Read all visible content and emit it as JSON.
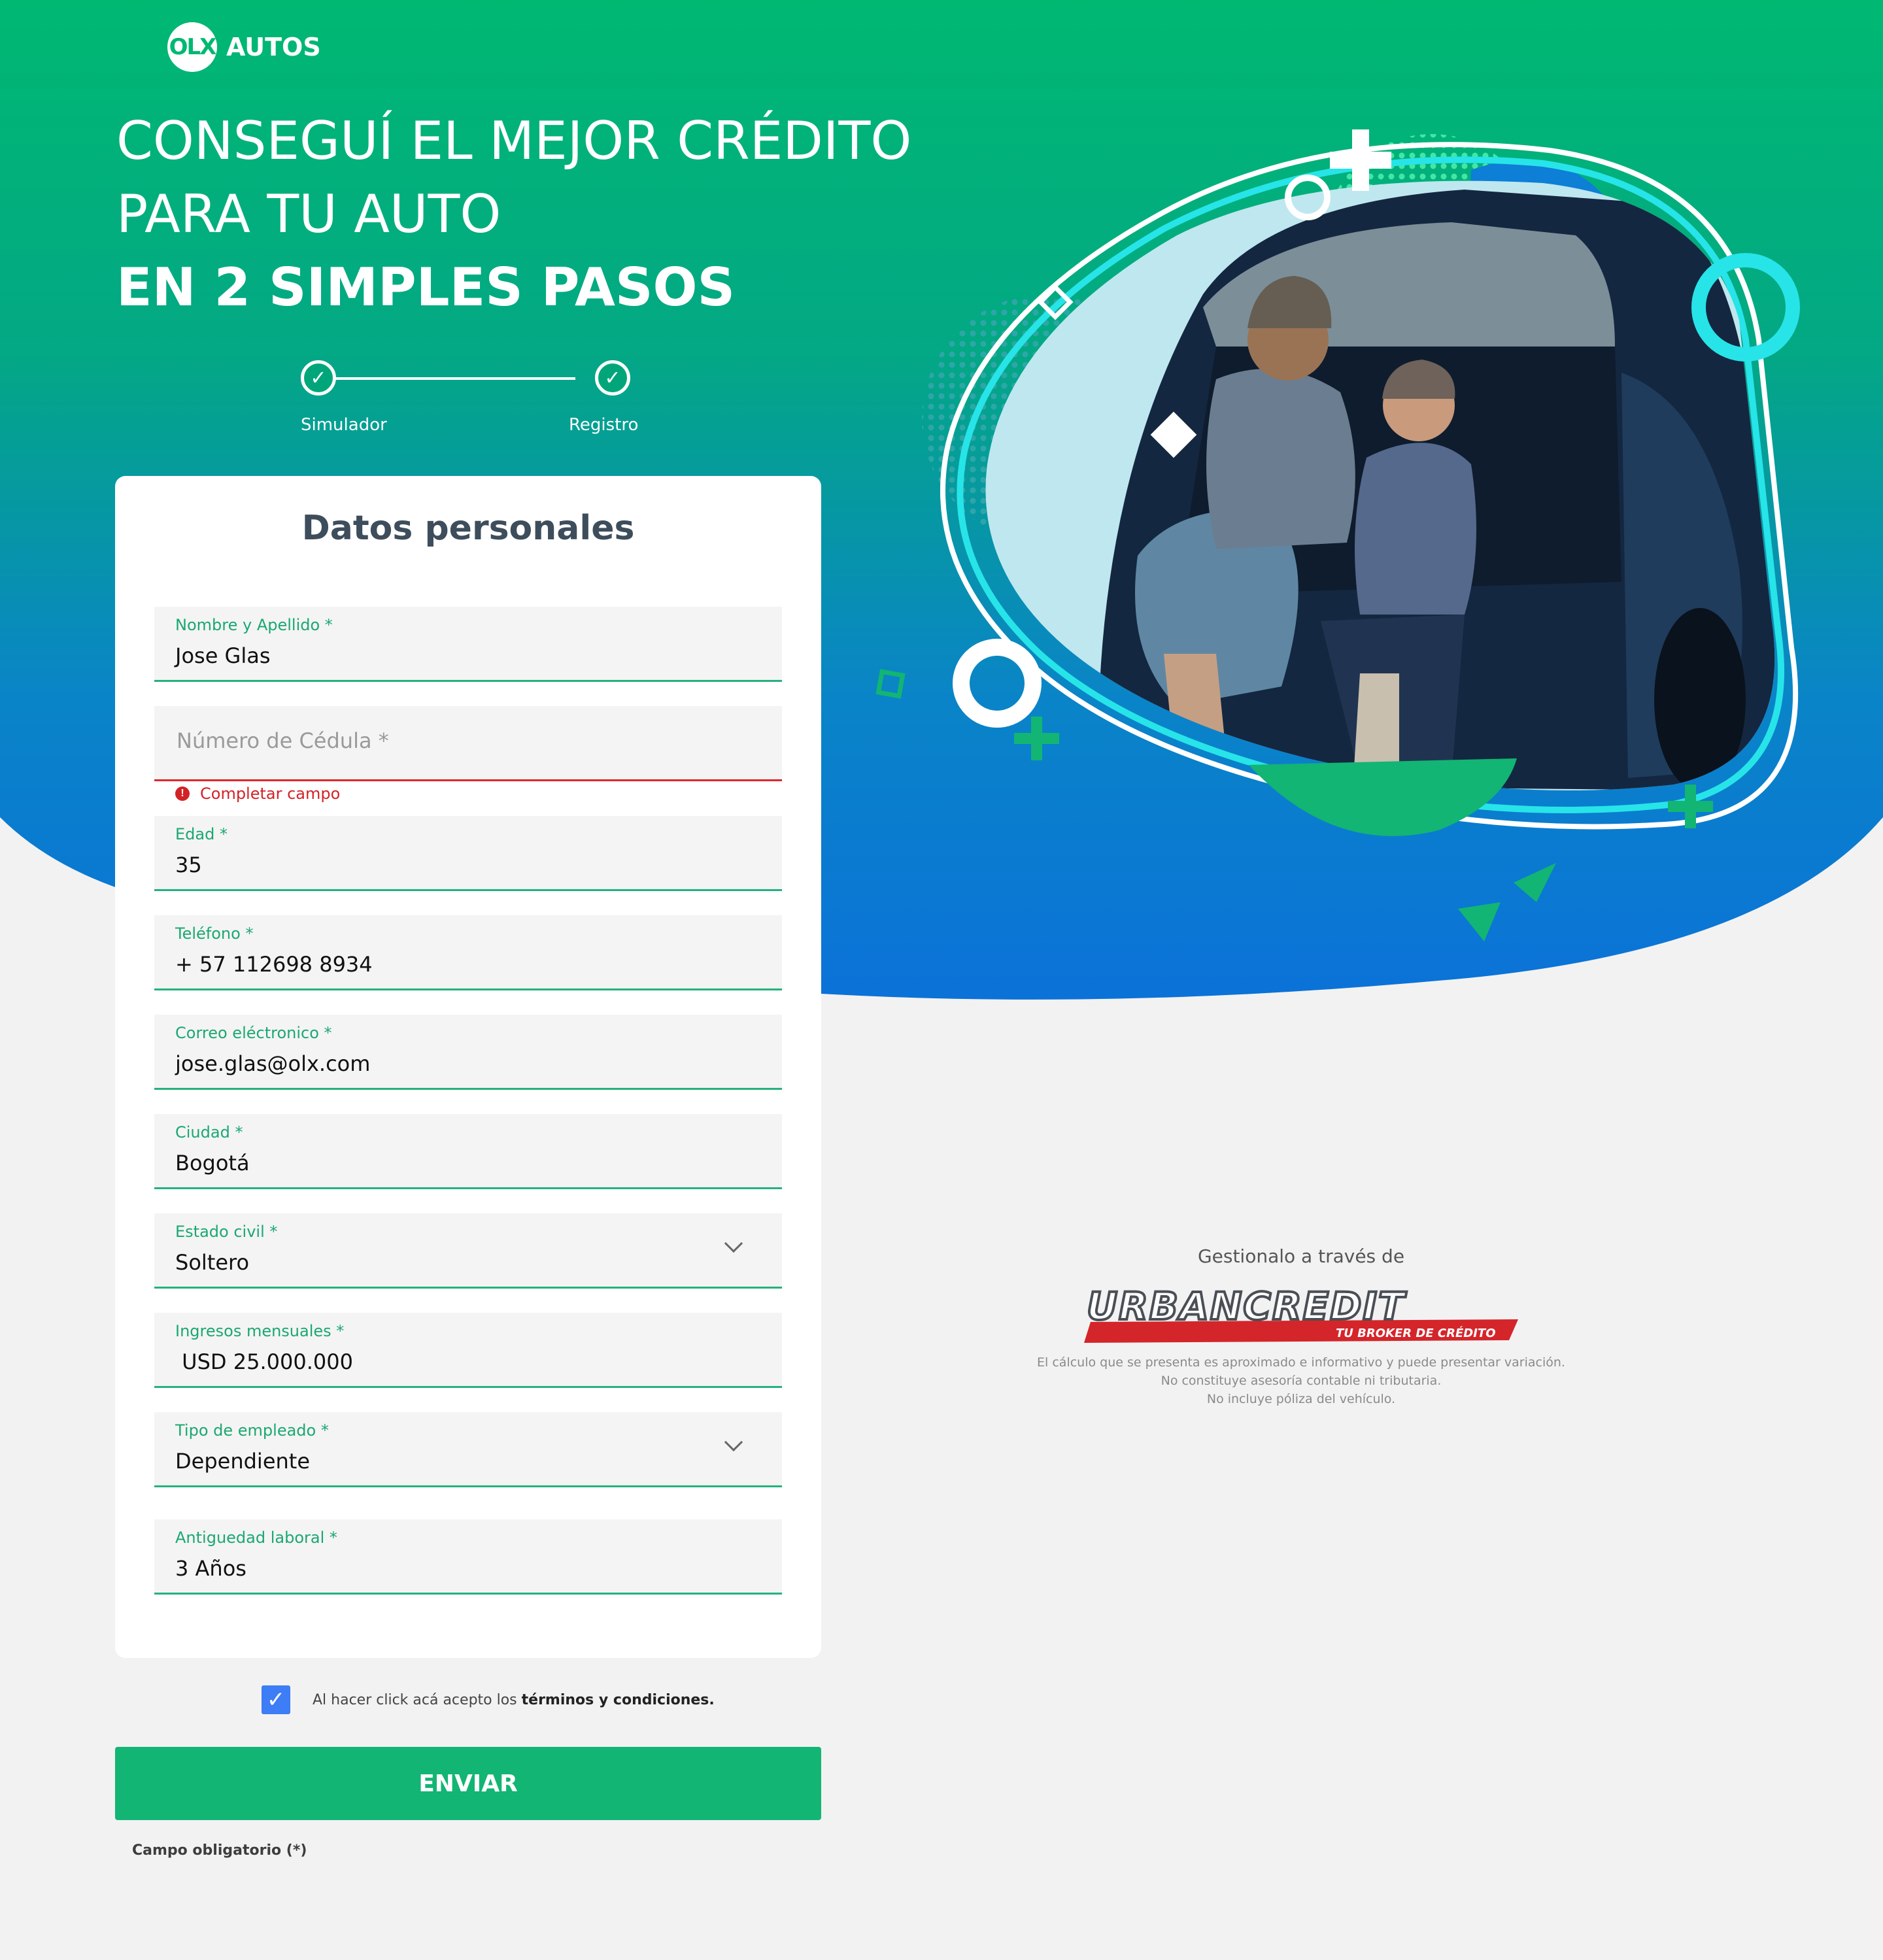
{
  "brand": {
    "logo_mark": "OLX",
    "logo_text": "AUTOS",
    "primary_color": "#00b872",
    "secondary_color": "#0b7bd8"
  },
  "hero": {
    "line1": "CONSEGUÍ EL MEJOR CRÉDITO",
    "line2": "PARA TU AUTO",
    "line3": "EN 2 SIMPLES PASOS"
  },
  "stepper": {
    "steps": [
      {
        "label": "Simulador",
        "icon": "check-icon"
      },
      {
        "label": "Registro",
        "icon": "check-icon"
      }
    ]
  },
  "form": {
    "title": "Datos personales",
    "fields": [
      {
        "label": "Nombre y Apellido *",
        "value": "Jose Glas"
      },
      {
        "placeholder": "Número de Cédula *",
        "error": "Completar campo"
      },
      {
        "label": "Edad *",
        "value": "35"
      },
      {
        "label": "Teléfono *",
        "value": "+ 57 112698 8934"
      },
      {
        "label": "Correo eléctronico *",
        "value": "jose.glas@olx.com"
      },
      {
        "label": "Ciudad *",
        "value": "Bogotá"
      },
      {
        "label": "Estado civil *",
        "value": "Soltero"
      },
      {
        "label": "Ingresos mensuales *",
        "value": " USD 25.000.000"
      },
      {
        "label": "Tipo de empleado *",
        "value": "Dependiente"
      },
      {
        "label": "Antiguedad laboral *",
        "value": "3 Años"
      }
    ]
  },
  "terms": {
    "prefix": "Al hacer click acá acepto los ",
    "link": "términos y condiciones.",
    "checked": true
  },
  "submit_label": "ENVIAR",
  "required_note": "Campo obligatorio (*)",
  "partner": {
    "intro": "Gestionalo a través de",
    "logo_text": "URBANCREDIT",
    "tagline": "TU BROKER DE CRÉDITO",
    "disclaimer": [
      "El cálculo que se presenta es aproximado e informativo y puede presentar variación.",
      "No constituye asesoría contable ni tributaria.",
      "No incluye póliza del vehículo."
    ]
  }
}
